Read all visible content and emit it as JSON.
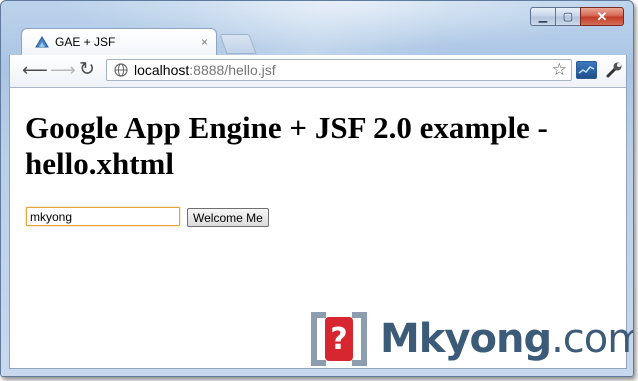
{
  "browser": {
    "tab_title": "GAE + JSF",
    "tab_close": "×",
    "window_controls": {
      "minimize": "▁",
      "maximize": "▢",
      "close": "✕"
    },
    "address": {
      "host": "localhost",
      "rest": ":8888/hello.jsf"
    },
    "icons": {
      "back": "back-arrow-icon",
      "forward": "forward-arrow-icon",
      "reload": "reload-icon",
      "page": "globe-icon",
      "bookmark": "star-icon",
      "extension": "chart-extension-icon",
      "menu": "wrench-icon"
    }
  },
  "page": {
    "heading": "Google App Engine + JSF 2.0 example - hello.xhtml",
    "name_value": "mkyong",
    "button_label": "Welcome Me"
  },
  "watermark": {
    "brand": "Mkyong",
    "suffix": ".com"
  },
  "colors": {
    "focus_border": "#e5a33d",
    "watermark": "#3c5b78",
    "close_button": "#c13a26"
  }
}
